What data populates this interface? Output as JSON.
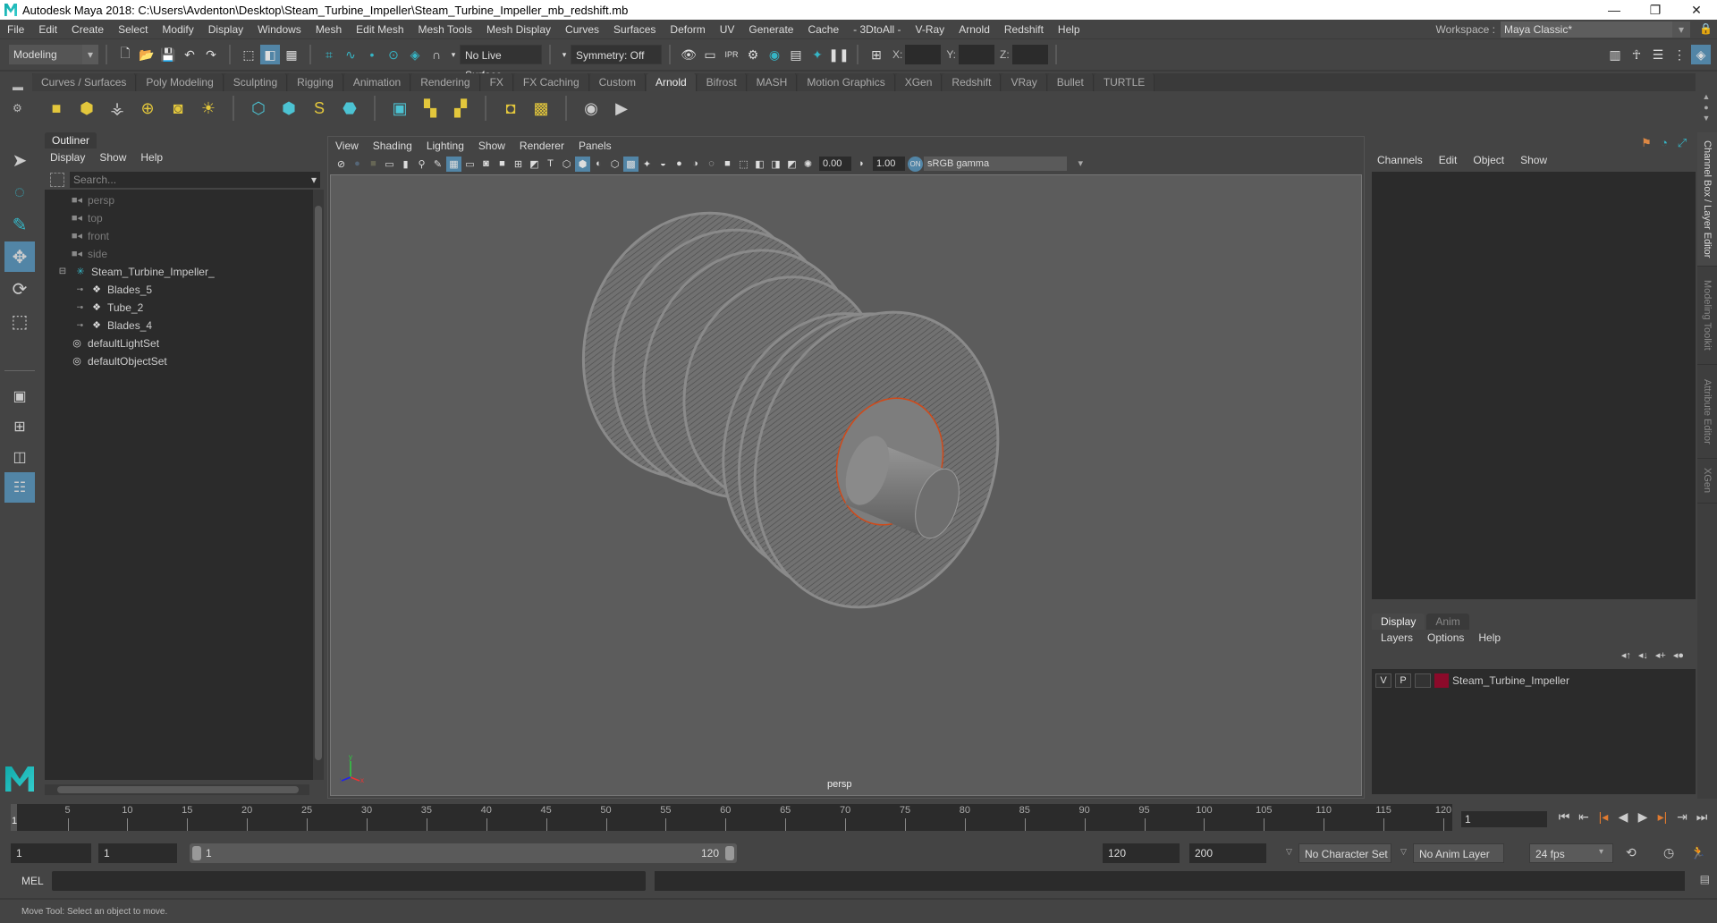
{
  "window": {
    "title": "Autodesk Maya 2018: C:\\Users\\Avdenton\\Desktop\\Steam_Turbine_Impeller\\Steam_Turbine_Impeller_mb_redshift.mb",
    "controls": {
      "minimize": "—",
      "maximize": "❐",
      "close": "✕"
    }
  },
  "menubar": {
    "items": [
      "File",
      "Edit",
      "Create",
      "Select",
      "Modify",
      "Display",
      "Windows",
      "Mesh",
      "Edit Mesh",
      "Mesh Tools",
      "Mesh Display",
      "Curves",
      "Surfaces",
      "Deform",
      "UV",
      "Generate",
      "Cache",
      "- 3DtoAll -",
      "V-Ray",
      "Arnold",
      "Redshift",
      "Help"
    ],
    "workspace_label": "Workspace :",
    "workspace_value": "Maya Classic*"
  },
  "statusline": {
    "mode": "Modeling",
    "live_surface": "No Live Surface",
    "symmetry": "Symmetry: Off",
    "x_label": "X:",
    "y_label": "Y:",
    "z_label": "Z:",
    "x_value": "",
    "y_value": "",
    "z_value": ""
  },
  "shelf": {
    "tabs": [
      "Curves / Surfaces",
      "Poly Modeling",
      "Sculpting",
      "Rigging",
      "Animation",
      "Rendering",
      "FX",
      "FX Caching",
      "Custom",
      "Arnold",
      "Bifrost",
      "MASH",
      "Motion Graphics",
      "XGen",
      "Redshift",
      "VRay",
      "Bullet",
      "TURTLE"
    ],
    "active_tab": "Arnold",
    "icons": [
      "area-light",
      "mesh-light",
      "photometric-light",
      "skydome-light",
      "light-portal",
      "physical-sky",
      "standin",
      "create-standin",
      "curve-collector",
      "volume",
      "render-view",
      "flush-cache",
      "delete-cache",
      "material-assign",
      "texture-assign",
      "arnold-render-view",
      "arnold-render"
    ]
  },
  "outliner": {
    "tab": "Outliner",
    "menus": [
      "Display",
      "Show",
      "Help"
    ],
    "search_placeholder": "Search...",
    "items": [
      {
        "label": "persp",
        "type": "camera",
        "dim": true
      },
      {
        "label": "top",
        "type": "camera",
        "dim": true
      },
      {
        "label": "front",
        "type": "camera",
        "dim": true
      },
      {
        "label": "side",
        "type": "camera",
        "dim": true
      },
      {
        "label": "Steam_Turbine_Impeller_",
        "type": "group",
        "dim": false
      },
      {
        "label": "Blades_5",
        "type": "mesh",
        "dim": false
      },
      {
        "label": "Tube_2",
        "type": "mesh",
        "dim": false
      },
      {
        "label": "Blades_4",
        "type": "mesh",
        "dim": false
      },
      {
        "label": "defaultLightSet",
        "type": "set",
        "dim": false
      },
      {
        "label": "defaultObjectSet",
        "type": "set",
        "dim": false
      }
    ]
  },
  "viewport": {
    "menus": [
      "View",
      "Shading",
      "Lighting",
      "Show",
      "Renderer",
      "Panels"
    ],
    "exposure": "0.00",
    "gamma": "1.00",
    "color_space": "sRGB gamma",
    "camera_label": "persp",
    "axis": {
      "x": "x",
      "y": "y",
      "z": "z"
    }
  },
  "channelbox": {
    "menus": [
      "Channels",
      "Edit",
      "Object",
      "Show"
    ]
  },
  "layereditor": {
    "tabs": [
      "Display",
      "Anim"
    ],
    "active_tab": "Display",
    "menus": [
      "Layers",
      "Options",
      "Help"
    ],
    "layers": [
      {
        "visible": "V",
        "playback": "P",
        "name": "Steam_Turbine_Impeller",
        "color": "#8b0a2a"
      }
    ]
  },
  "side_tabs": [
    "Channel Box / Layer Editor",
    "Modeling Toolkit",
    "Attribute Editor",
    "XGen"
  ],
  "timeslider": {
    "start": 1,
    "end": 120,
    "major_ticks": [
      5,
      10,
      15,
      20,
      25,
      30,
      35,
      40,
      45,
      50,
      55,
      60,
      65,
      70,
      75,
      80,
      85,
      90,
      95,
      100,
      105,
      110,
      115,
      120
    ],
    "current_frame": "1",
    "current_frame_field": "1"
  },
  "rangeslider": {
    "start_time": "1",
    "playback_start": "1",
    "range_start_label": "1",
    "range_end_label": "120",
    "playback_end": "120",
    "end_time": "200",
    "character_set": "No Character Set",
    "anim_layer": "No Anim Layer",
    "fps": "24 fps"
  },
  "commandline": {
    "label": "MEL",
    "input": ""
  },
  "helpline": {
    "text": "Move Tool: Select an object to move."
  },
  "colors": {
    "accent": "#5285a6",
    "teal": "#36b5c5",
    "playback_key": "#e07a30",
    "layer_color": "#8b0a2a"
  }
}
